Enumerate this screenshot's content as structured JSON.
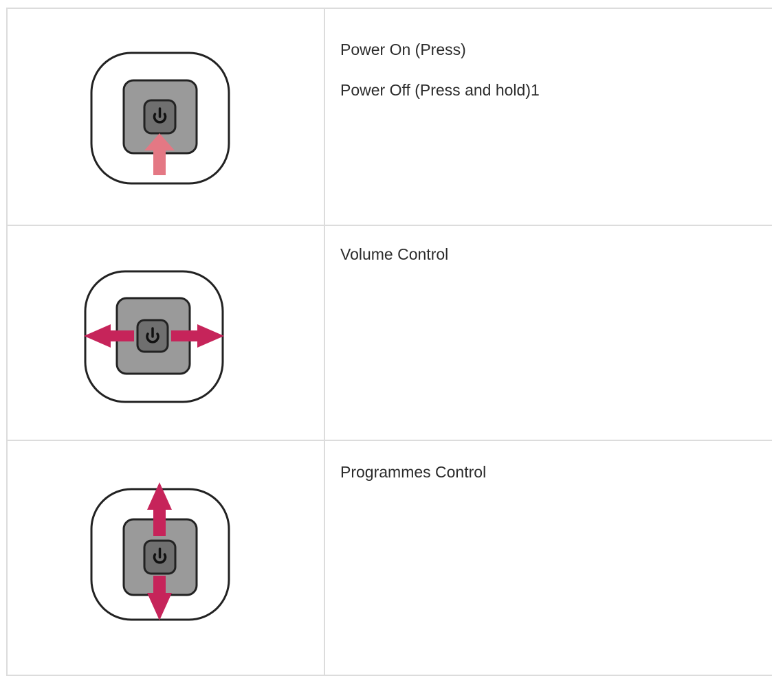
{
  "rows": [
    {
      "icon": "joystick-press-up-icon",
      "lines": [
        "Power On (Press)",
        "Power Off (Press and hold)1"
      ]
    },
    {
      "icon": "joystick-left-right-icon",
      "lines": [
        "Volume Control"
      ]
    },
    {
      "icon": "joystick-up-down-icon",
      "lines": [
        "Programmes Control"
      ]
    }
  ],
  "colors": {
    "press_arrow": "#e47884",
    "move_arrow": "#c6245a",
    "outer_outline": "#222222",
    "button_fill": "#9a9a9a",
    "power_key_fill": "#6f6f6f",
    "grid_line": "#dcdcdc"
  }
}
